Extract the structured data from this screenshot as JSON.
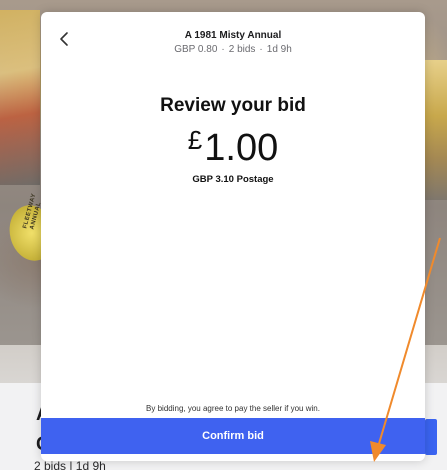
{
  "background": {
    "title_first_line": "A",
    "title_second_line": "C",
    "meta": "2 bids | 1d 9h",
    "badge_text": "FLEETWAY ANNUAL"
  },
  "header": {
    "item_title": "A 1981 Misty Annual",
    "price": "GBP 0.80",
    "bids": "2 bids",
    "time_left": "1d 9h",
    "separator": "·"
  },
  "review": {
    "title": "Review your bid",
    "currency_symbol": "£",
    "amount": "1.00",
    "postage": "GBP 3.10 Postage"
  },
  "footer": {
    "agreement": "By bidding, you agree to pay the seller if you win.",
    "confirm_label": "Confirm bid"
  },
  "colors": {
    "accent": "#3f62f0",
    "annotation_arrow": "#f08a2c"
  }
}
